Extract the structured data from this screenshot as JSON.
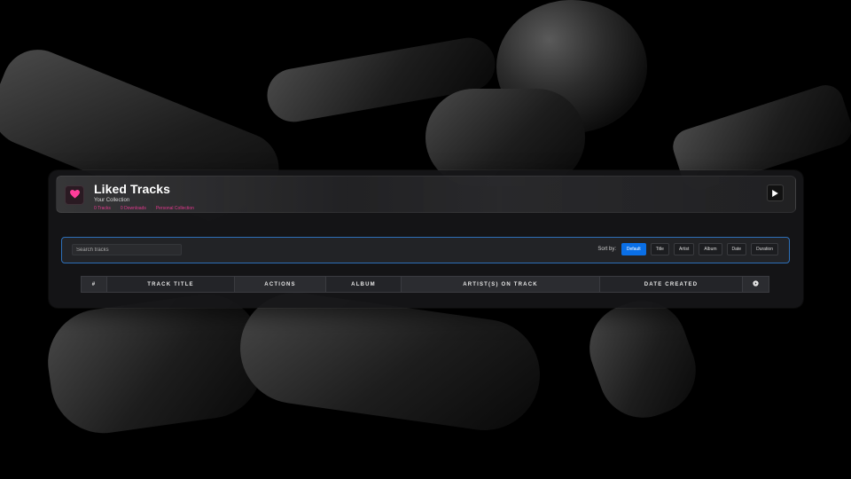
{
  "header": {
    "title": "Liked Tracks",
    "subtitle": "Your Collection",
    "meta": [
      "0 Tracks",
      "0 Downloads",
      "Personal Collection"
    ],
    "accent_color": "#e4388f",
    "heart_icon": "heart-icon",
    "play_icon": "play-icon"
  },
  "controls": {
    "search_placeholder": "Search tracks",
    "sort_label": "Sort by:",
    "sort_options": [
      "Default",
      "Title",
      "Artist",
      "Album",
      "Date",
      "Duration"
    ],
    "active_sort": "Default",
    "active_color": "#0a6fe6"
  },
  "table": {
    "columns": [
      "#",
      "TRACK TITLE",
      "ACTIONS",
      "ALBUM",
      "ARTIST(S) ON TRACK",
      "DATE CREATED"
    ],
    "settings_icon": "settings-icon"
  }
}
